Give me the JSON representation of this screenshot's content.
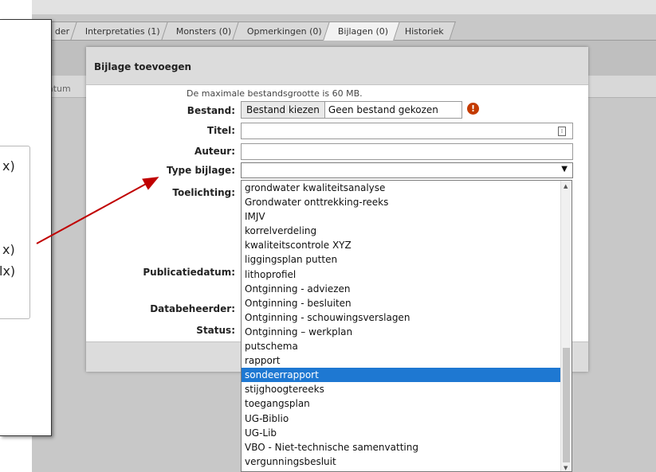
{
  "tabs": [
    {
      "label": "der"
    },
    {
      "label": "Interpretaties (1)"
    },
    {
      "label": "Monsters (0)"
    },
    {
      "label": "Opmerkingen (0)"
    },
    {
      "label": "Bijlagen (0)"
    },
    {
      "label": "Historiek"
    }
  ],
  "background": {
    "column_header": "atum"
  },
  "modal": {
    "title": "Bijlage toevoegen",
    "max_size_note": "De maximale bestandsgrootte is 60 MB.",
    "labels": {
      "bestand": "Bestand:",
      "titel": "Titel:",
      "auteur": "Auteur:",
      "type_bijlage": "Type bijlage:",
      "toelichting": "Toelichting:",
      "publicatiedatum": "Publicatiedatum:",
      "databeheerder": "Databeheerder:",
      "status": "Status:"
    },
    "file_button_label": "Bestand kiezen",
    "file_status": "Geen bestand gekozen",
    "warning_glyph": "!",
    "type_bijlage_value": ""
  },
  "dropdown": {
    "options": [
      "grondwater kwaliteitsanalyse",
      "Grondwater onttrekking-reeks",
      "IMJV",
      "korrelverdeling",
      "kwaliteitscontrole XYZ",
      "liggingsplan putten",
      "lithoprofiel",
      "Ontginning - adviezen",
      "Ontginning - besluiten",
      "Ontginning - schouwingsverslagen",
      "Ontginning – werkplan",
      "putschema",
      "rapport",
      "sondeerrapport",
      "stijghoogtereeks",
      "toegangsplan",
      "UG-Biblio",
      "UG-Lib",
      "VBO - Niet-technische samenvatting",
      "vergunningsbesluit"
    ],
    "selected": "sondeerrapport"
  },
  "callout": {
    "fragments": [
      "x)",
      "x)",
      "lx)"
    ]
  },
  "colors": {
    "selection": "#1e78d2",
    "warning": "#c43b00",
    "annotation_arrow": "#c00000"
  }
}
